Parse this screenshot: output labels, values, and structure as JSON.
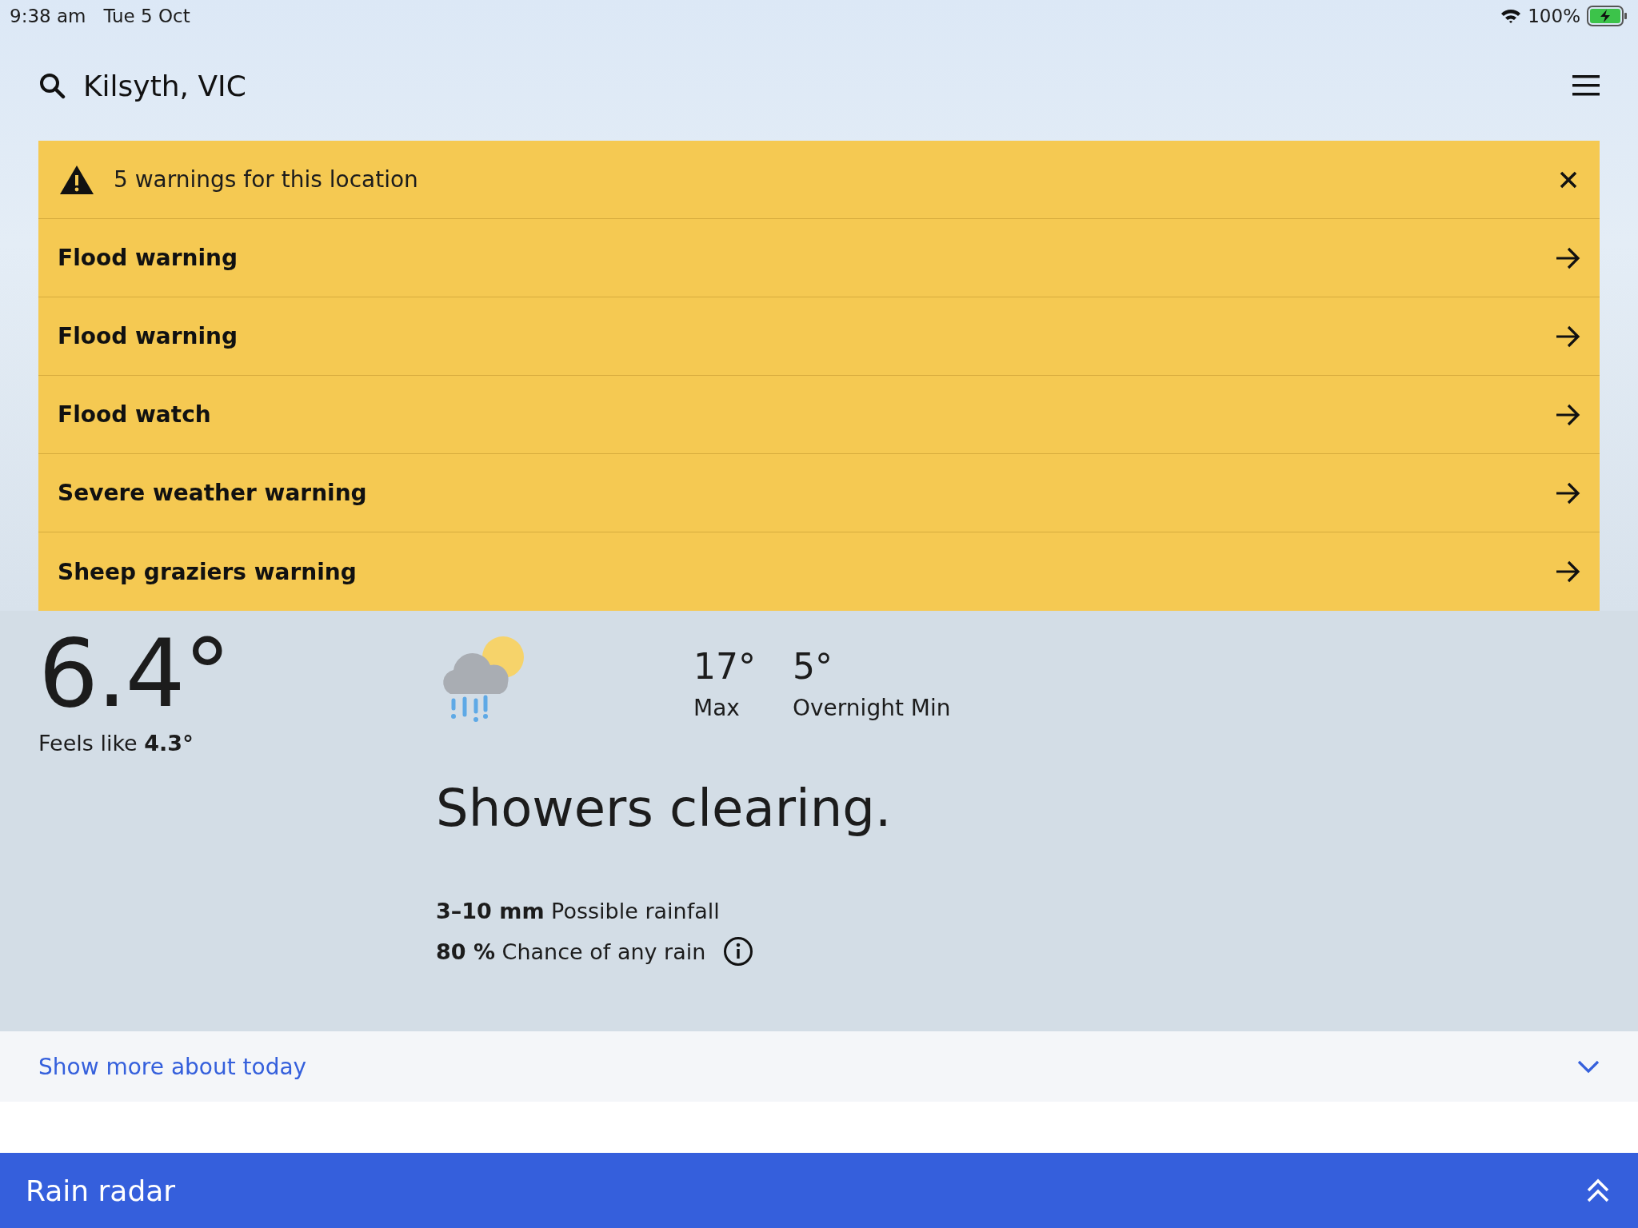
{
  "status_bar": {
    "time": "9:38 am",
    "date": "Tue 5 Oct",
    "battery": "100%"
  },
  "header": {
    "location": "Kilsyth, VIC"
  },
  "warnings": {
    "summary": "5 warnings for this location",
    "items": [
      {
        "label": "Flood warning"
      },
      {
        "label": "Flood warning"
      },
      {
        "label": "Flood watch"
      },
      {
        "label": "Severe weather warning"
      },
      {
        "label": "Sheep graziers warning"
      }
    ]
  },
  "current": {
    "temperature": "6.4°",
    "feels_like": "Feels like **4.3°**"
  },
  "forecast": {
    "max": "17°",
    "max_label": "Max",
    "min": "5°",
    "min_label": "Overnight Min",
    "summary": "Showers clearing.",
    "rainfall": "**3–10 mm** Possible rainfall",
    "chance": "**80 %** Chance of any rain"
  },
  "show_more": "Show more about today",
  "rain_radar": "Rain radar"
}
